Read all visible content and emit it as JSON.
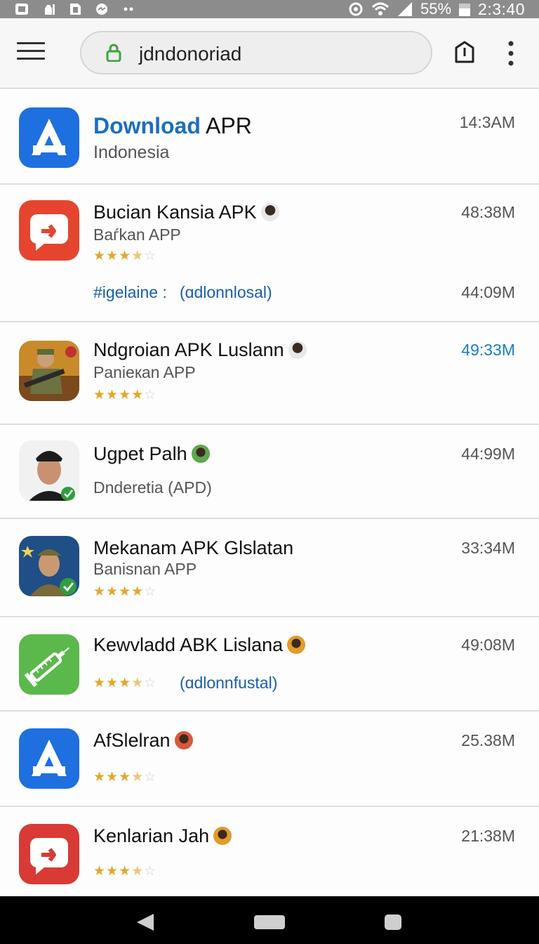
{
  "status_bar": {
    "battery": "55%",
    "time": "2:3:40"
  },
  "browser": {
    "url": "jdndonoriad"
  },
  "colors": {
    "link": "#1a5fa8",
    "highlight_blue": "#1a6fc0",
    "star": "#e4a72b"
  },
  "apps": [
    {
      "title_highlight": "Download",
      "title_rest": " APR",
      "subtitle": "Indonesia",
      "size": "14:3AM",
      "icon": "app-store-blue-icon"
    },
    {
      "title": "Bucian Kansia APK",
      "subtitle": "Baѓkan APP",
      "size": "48:38M",
      "rating": 3.5,
      "link_tag": "#igelaine :",
      "link_text": "(ɑdlonnlosal)",
      "link_size": "44:09M",
      "icon": "video-play-red-icon"
    },
    {
      "title": "Ndgroian APK Luslann",
      "subtitle": "Panieкan APP",
      "size": "49:33M",
      "rating": 4,
      "icon": "soldier-game-icon"
    },
    {
      "title": "Ugpet Palh",
      "subtitle": "Dnderetia (APD)",
      "size": "44:99M",
      "icon": "officer-portrait-icon"
    },
    {
      "title": "Mekanam APK Glslatan",
      "subtitle": "Banisnan APP",
      "size": "33:34M",
      "rating": 4,
      "icon": "soldier-verified-icon"
    },
    {
      "title": "Kewvladd ABK Lislana",
      "size": "49:08M",
      "rating": 3.5,
      "link_text": "(ɑdlonnfustal)",
      "icon": "syringe-green-icon"
    },
    {
      "title": "AfSlelran",
      "size": "25.38M",
      "rating": 3.5,
      "icon": "app-store-blue-icon"
    },
    {
      "title": "Kenlarian Jah",
      "size": "21:38M",
      "rating": 3.5,
      "icon": "video-play-red-icon"
    }
  ]
}
